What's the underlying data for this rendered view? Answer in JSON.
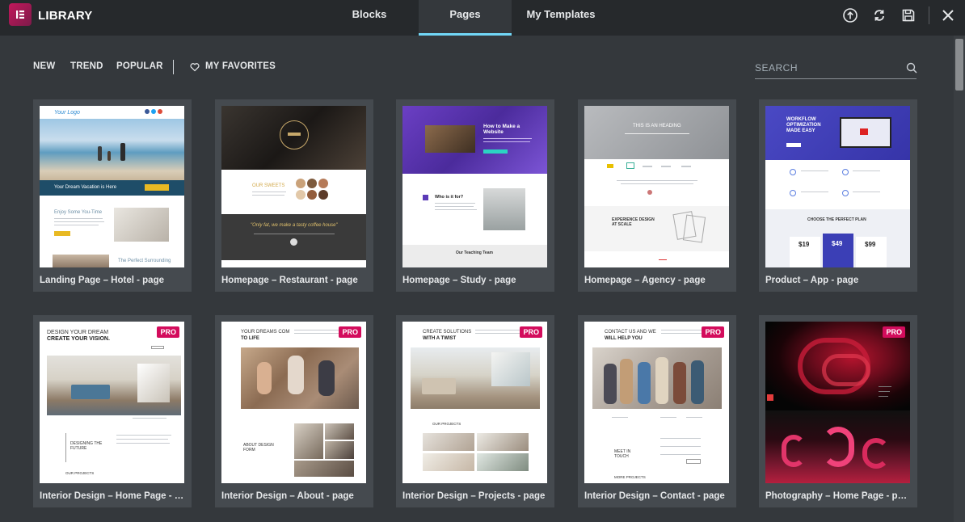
{
  "header": {
    "title": "LIBRARY",
    "tabs": [
      {
        "label": "Blocks",
        "active": false
      },
      {
        "label": "Pages",
        "active": true
      },
      {
        "label": "My Templates",
        "active": false
      }
    ],
    "icons": [
      "upload-icon",
      "sync-icon",
      "save-icon",
      "close-icon"
    ],
    "active_tab_color": "#71d7f7"
  },
  "filters": {
    "new": "NEW",
    "trend": "TREND",
    "popular": "POPULAR",
    "favorites": "MY FAVORITES"
  },
  "search": {
    "placeholder": "SEARCH"
  },
  "templates": [
    {
      "label": "Landing Page – Hotel - page",
      "pro": false
    },
    {
      "label": "Homepage – Restaurant - page",
      "pro": false
    },
    {
      "label": "Homepage – Study - page",
      "pro": false
    },
    {
      "label": "Homepage – Agency - page",
      "pro": false
    },
    {
      "label": "Product – App - page",
      "pro": false
    },
    {
      "label": "Interior Design – Home Page - page",
      "pro": true,
      "badge": "PRO"
    },
    {
      "label": "Interior Design – About - page",
      "pro": true,
      "badge": "PRO"
    },
    {
      "label": "Interior Design – Projects - page",
      "pro": true,
      "badge": "PRO"
    },
    {
      "label": "Interior Design – Contact - page",
      "pro": true,
      "badge": "PRO"
    },
    {
      "label": "Photography – Home Page - page",
      "pro": true,
      "badge": "PRO"
    }
  ],
  "thumb_text": {
    "hotel_logo": "Your Logo",
    "hotel_banner": "Your Dream Vacation is Here",
    "hotel_section": "Enjoy Some You-Time",
    "hotel_section2": "The Perfect Surrounding",
    "rest_sweets": "OUR SWEETS",
    "rest_quote": "\"Only fat, we make a tasty coffee house\"",
    "study_title": "How to Make a Website",
    "study_who": "Who is it for?",
    "study_team": "Our Teaching Team",
    "agency_heading": "THIS IS AN HEADING",
    "agency_exp": "EXPERIENCE DESIGN AT SCALE",
    "app_title": "WORKFLOW OPTIMIZATION MADE EASY",
    "app_plan": "CHOOSE THE PERFECT PLAN",
    "app_prices": [
      "$19",
      "$49",
      "$99"
    ],
    "int_home_1": "DESIGN YOUR DREAM",
    "int_home_2": "CREATE YOUR VISION.",
    "int_home_3": "DESIGNING THE FUTURE",
    "int_home_4": "OUR PROJECTS",
    "int_about_1": "YOUR DREAMS COM",
    "int_about_2": "TO LIFE",
    "int_about_3": "ABOUT DESIGN FORM",
    "int_proj_1": "CREATE SOLUTIONS",
    "int_proj_2": "WITH A TWIST",
    "int_proj_3": "OUR PROJECTS",
    "int_contact_1": "CONTACT US AND WE",
    "int_contact_2": "WILL HELP YOU",
    "int_contact_3": "MEET IN TOUCH",
    "int_contact_4": "MORE PROJECTS"
  }
}
